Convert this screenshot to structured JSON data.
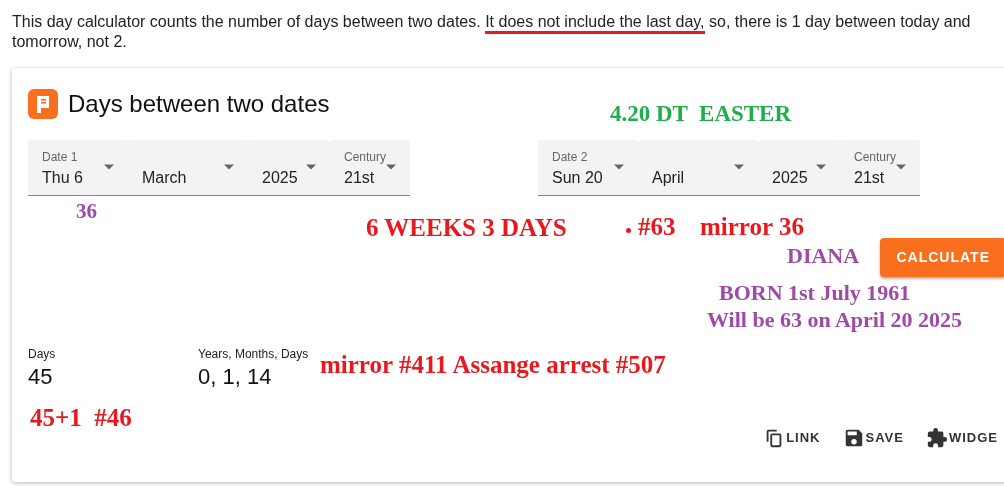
{
  "intro": [
    {
      "text": "This day calculator counts the number of days between two dates. ",
      "underlined": false
    },
    {
      "text": "It does not include the last day,",
      "underlined": true
    },
    {
      "text": " so, there is 1 day between today and tomorrow, not 2.",
      "underlined": false
    }
  ],
  "card": {
    "title": "Days between two dates",
    "date_groups": [
      {
        "fields": [
          {
            "label": "Date 1",
            "value": "Thu 6"
          },
          {
            "value": "March"
          },
          {
            "value": "2025"
          },
          {
            "label": "Century",
            "value": "21st"
          }
        ]
      },
      {
        "fields": [
          {
            "label": "Date 2",
            "value": "Sun 20"
          },
          {
            "value": "April"
          },
          {
            "value": "2025"
          },
          {
            "label": "Century",
            "value": "21st"
          }
        ]
      }
    ],
    "calculate_button": "CALCULATE",
    "results": [
      {
        "label": "Days",
        "value": "45"
      },
      {
        "label": "Years, Months, Days",
        "value": "0, 1, 14"
      }
    ],
    "actions": [
      {
        "kind": "link",
        "label": "LINK"
      },
      {
        "kind": "save",
        "label": "SAVE"
      },
      {
        "kind": "widget",
        "label": "WIDGE"
      }
    ]
  },
  "annotations": [
    {
      "text": "4.20 DT  EASTER",
      "color": "#1fae4b"
    },
    {
      "text": "36",
      "color": "#a04aa8"
    },
    {
      "text": "6 WEEKS 3 DAYS",
      "color": "#e8191e"
    },
    {
      "text": "#63",
      "color": "#e8191e"
    },
    {
      "text": "mirror 36",
      "color": "#e8191e"
    },
    {
      "text": "DIANA",
      "color": "#a04aa8"
    },
    {
      "text": "BORN 1st July 1961",
      "color": "#a04aa8"
    },
    {
      "text": "Will be 63 on April 20 2025",
      "color": "#a04aa8"
    },
    {
      "text": "mirror #411 Assange arrest #507",
      "color": "#e8191e"
    },
    {
      "text": "45+1  #46",
      "color": "#e8191e"
    }
  ]
}
